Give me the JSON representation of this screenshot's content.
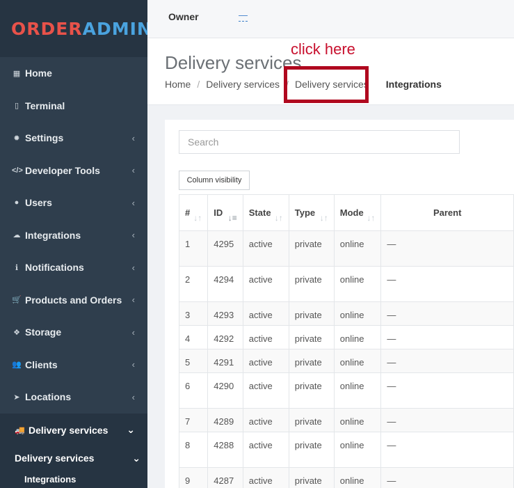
{
  "logo": {
    "part1": "ORDER",
    "part2": "ADMIN"
  },
  "nav": {
    "items": [
      {
        "icon": "▦",
        "label": "Home",
        "chevron": ""
      },
      {
        "icon": "▯",
        "label": "Terminal",
        "chevron": ""
      },
      {
        "icon": "✹",
        "label": "Settings",
        "chevron": "‹"
      },
      {
        "icon": "</>",
        "label": "Developer Tools",
        "chevron": "‹"
      },
      {
        "icon": "●",
        "label": "Users",
        "chevron": "‹"
      },
      {
        "icon": "☁",
        "label": "Integrations",
        "chevron": "‹"
      },
      {
        "icon": "ℹ",
        "label": "Notifications",
        "chevron": "‹"
      },
      {
        "icon": "🛒",
        "label": "Products and Orders",
        "chevron": "‹"
      },
      {
        "icon": "❖",
        "label": "Storage",
        "chevron": "‹"
      },
      {
        "icon": "👥",
        "label": "Clients",
        "chevron": "‹"
      },
      {
        "icon": "➤",
        "label": "Locations",
        "chevron": "‹"
      }
    ],
    "active": {
      "icon": "🚚",
      "label": "Delivery services",
      "chevron": "⌄"
    },
    "sub": {
      "label": "Delivery services",
      "chevron": "⌄"
    },
    "subsub": {
      "label": "Integrations"
    }
  },
  "topbar": {
    "owner_label": "Owner",
    "owner_value": "—"
  },
  "header": {
    "title": "Delivery services",
    "breadcrumb": [
      "Home",
      "Delivery services",
      "Delivery services"
    ],
    "current": "Integrations",
    "annotation": "click here"
  },
  "search": {
    "placeholder": "Search"
  },
  "column_visibility": "Column visibility",
  "table": {
    "columns": [
      "#",
      "ID",
      "State",
      "Type",
      "Mode",
      "Parent"
    ],
    "rows": [
      {
        "n": "1",
        "id": "4295",
        "state": "active",
        "type": "private",
        "mode": "online",
        "parent": "—",
        "h": "tall"
      },
      {
        "n": "2",
        "id": "4294",
        "state": "active",
        "type": "private",
        "mode": "online",
        "parent": "—",
        "h": "tall"
      },
      {
        "n": "3",
        "id": "4293",
        "state": "active",
        "type": "private",
        "mode": "online",
        "parent": "—",
        "h": "short"
      },
      {
        "n": "4",
        "id": "4292",
        "state": "active",
        "type": "private",
        "mode": "online",
        "parent": "—",
        "h": "short"
      },
      {
        "n": "5",
        "id": "4291",
        "state": "active",
        "type": "private",
        "mode": "online",
        "parent": "—",
        "h": "short"
      },
      {
        "n": "6",
        "id": "4290",
        "state": "active",
        "type": "private",
        "mode": "online",
        "parent": "—",
        "h": "tall"
      },
      {
        "n": "7",
        "id": "4289",
        "state": "active",
        "type": "private",
        "mode": "online",
        "parent": "—",
        "h": "short"
      },
      {
        "n": "8",
        "id": "4288",
        "state": "active",
        "type": "private",
        "mode": "online",
        "parent": "—",
        "h": "tall"
      },
      {
        "n": "9",
        "id": "4287",
        "state": "active",
        "type": "private",
        "mode": "online",
        "parent": "—",
        "h": "tall"
      }
    ]
  }
}
